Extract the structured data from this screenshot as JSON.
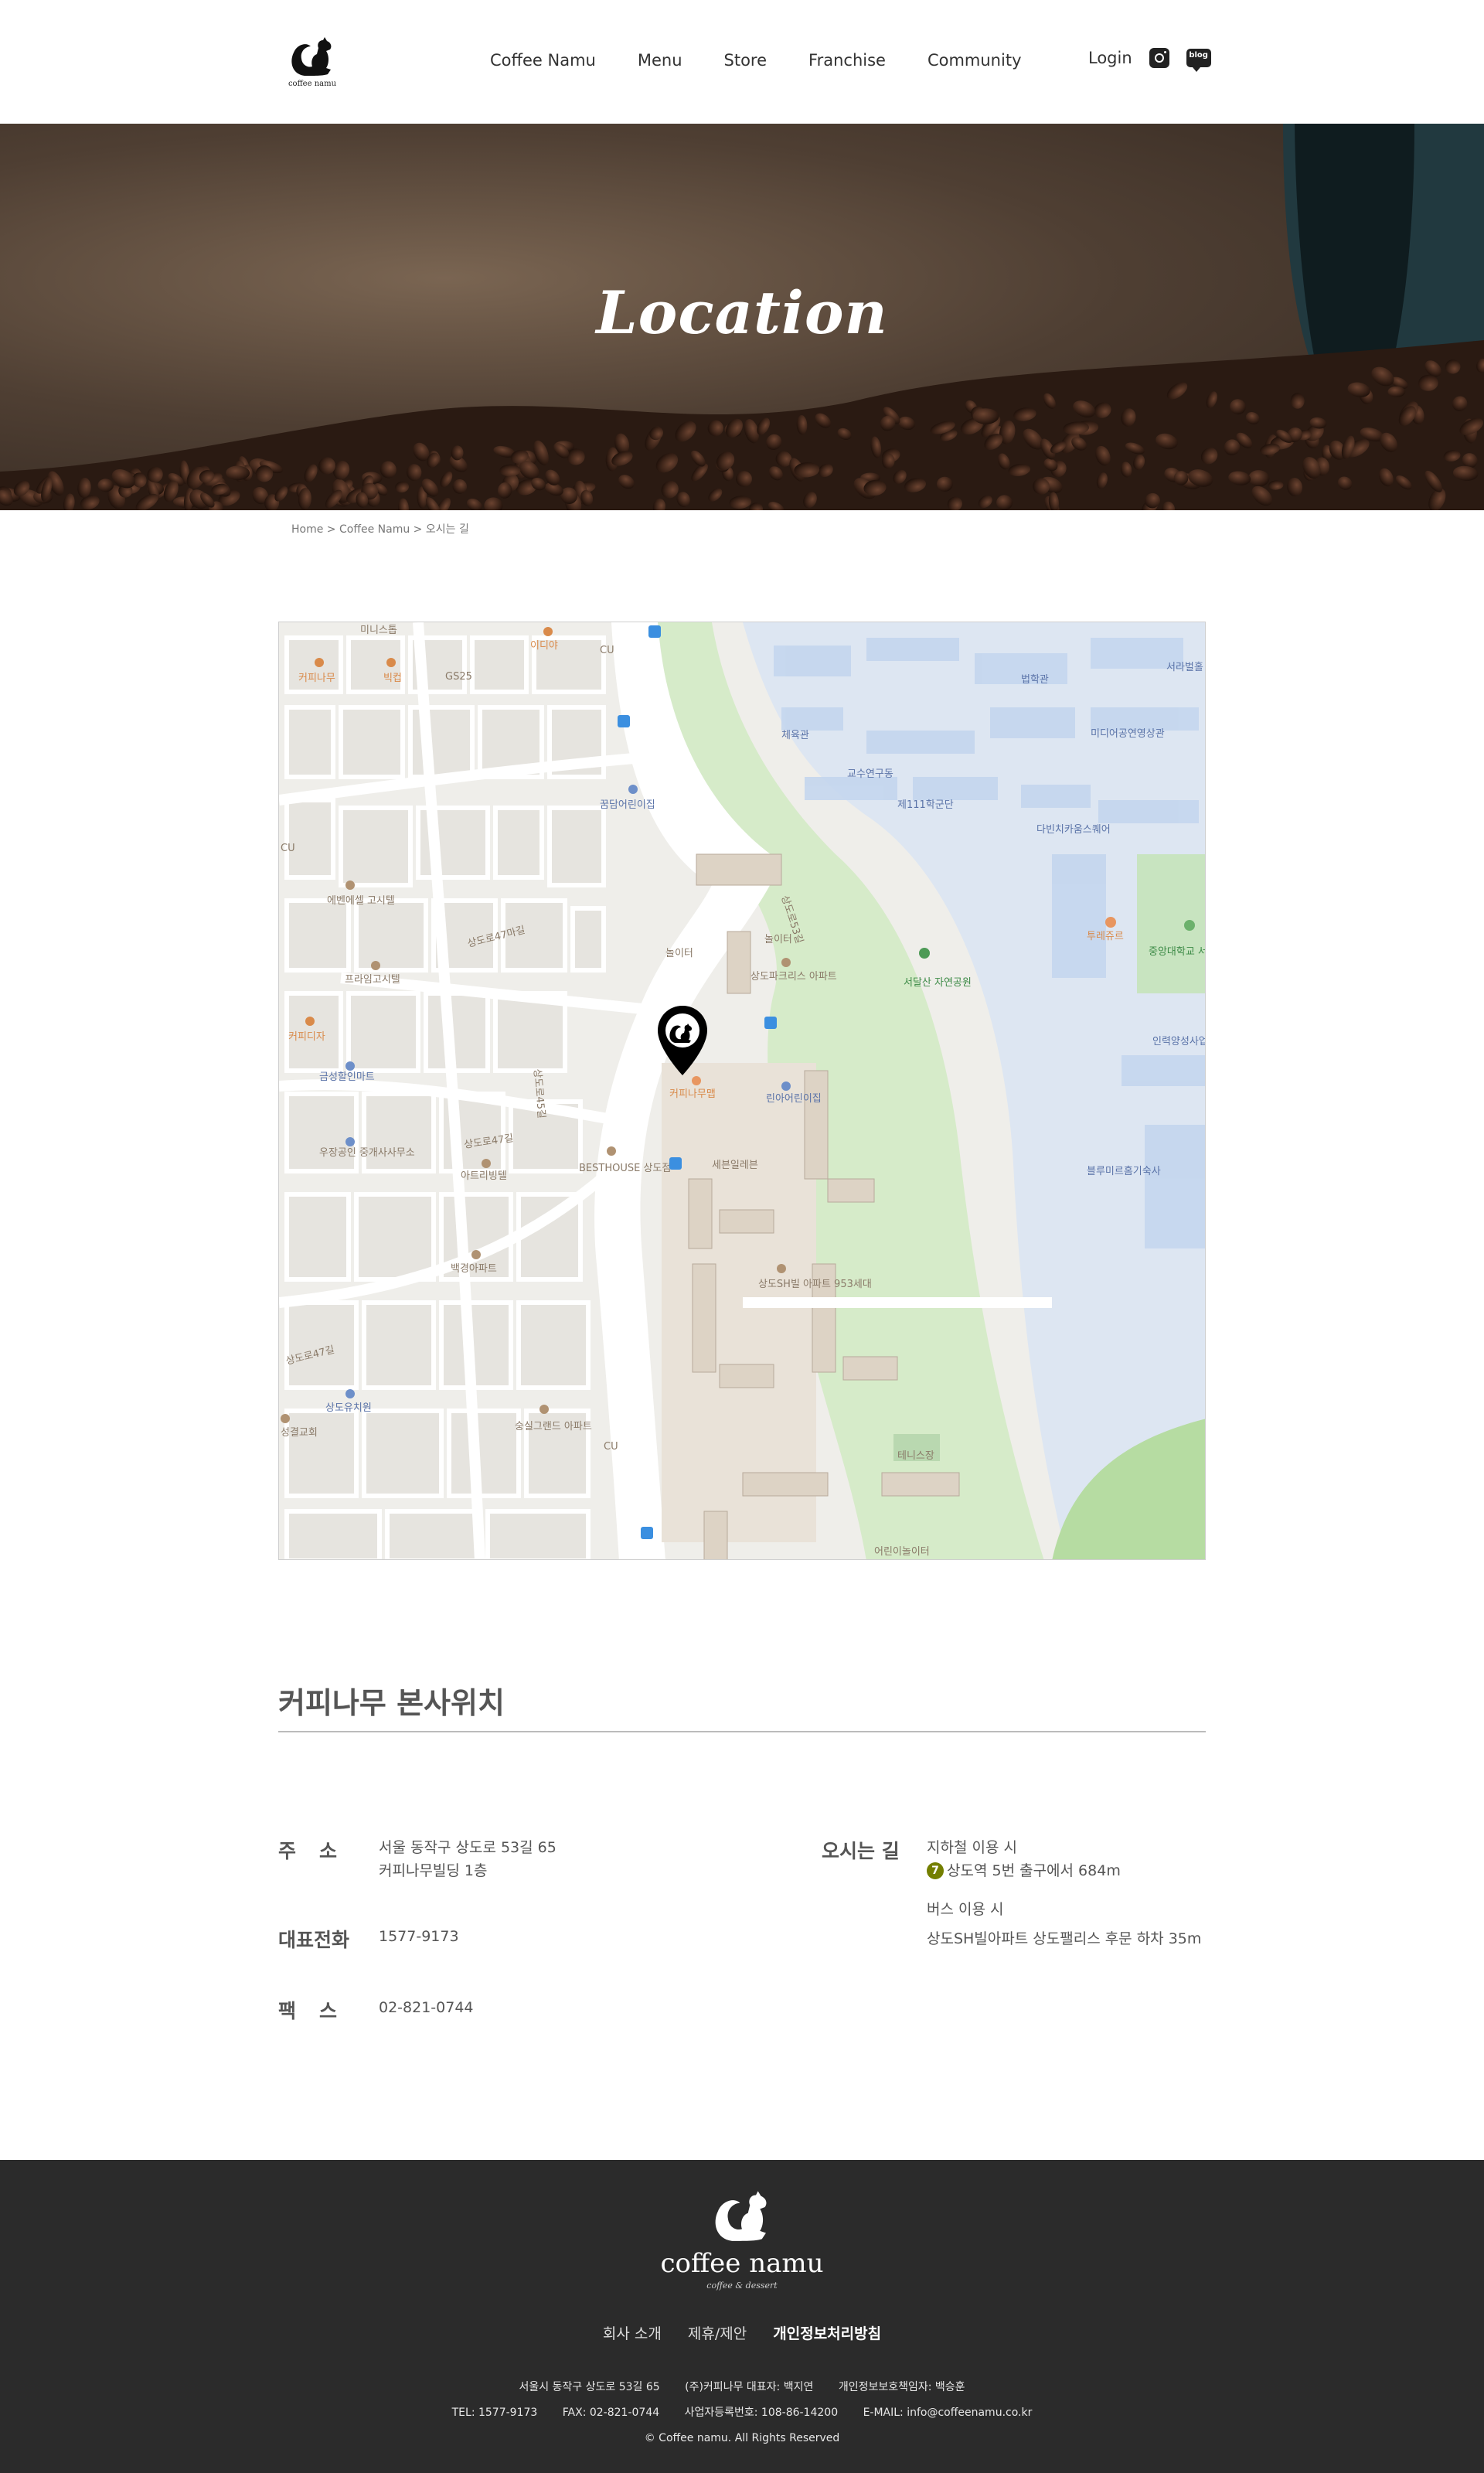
{
  "header": {
    "logo_text": "coffee namu",
    "nav": [
      "Coffee Namu",
      "Menu",
      "Store",
      "Franchise",
      "Community"
    ],
    "login": "Login",
    "blog_badge": "blog"
  },
  "hero": {
    "title": "Location"
  },
  "breadcrumb": {
    "home": "Home",
    "sep": ">",
    "section": "Coffee Namu",
    "page": "오시는 길"
  },
  "map": {
    "marker_label": "커피나무맵",
    "labels": {
      "l1": "미니스톱",
      "l2": "이디야",
      "l3": "CU",
      "l4": "커피나무",
      "l5": "빅컵",
      "l6": "GS25",
      "l7": "체육관",
      "l8": "법학관",
      "l9": "서라벌홀",
      "l10": "미디어공연영상관",
      "l11": "교수연구동",
      "l12": "제111학군단",
      "l13": "다빈치카움스퀘어",
      "l14": "꿈담어린이집",
      "l15": "CU",
      "l16": "에벤에셀 고시텔",
      "l17": "프라임고시텔",
      "l18": "투레쥬르",
      "l19": "중앙대학교 서울캠퍼스",
      "l20": "서달산 자연공원",
      "l21": "상도파크리스 아파트",
      "l22": "놀이터",
      "l23": "놀이터",
      "l24": "커피디자",
      "l25": "금성할인마트",
      "l26": "인력양성사업",
      "l27": "린아어린이집",
      "l28": "우장공인 중개사사무소",
      "l29": "아트리빙텔",
      "l30": "BESTHOUSE 상도점",
      "l31": "세븐일레븐",
      "l32": "블루미르홈기숙사",
      "l33": "백경아파트",
      "l34": "상도SH빌 아파트 953세대",
      "l35": "상도유치원",
      "l36": "숭실그랜드 아파트",
      "l37": "성결교회",
      "l38": "테니스장",
      "l39": "어린이놀이터",
      "l40": "CU",
      "r1": "상도로53길",
      "r2": "상도로47마길",
      "r3": "상도로47길",
      "r4": "상도로45길"
    }
  },
  "info": {
    "title": "커피나무 본사위치",
    "address_label": "주소",
    "address_line1": "서울 동작구 상도로 53길 65",
    "address_line2": "커피나무빌딩 1층",
    "phone_label": "대표전화",
    "phone": "1577-9173",
    "fax_label": "팩스",
    "fax": "02-821-0744",
    "directions_label": "오시는 길",
    "subway_title": "지하철 이용 시",
    "subway_line": "7",
    "subway_text": "상도역 5번 출구에서 684m",
    "bus_title": "버스 이용 시",
    "bus_text": "상도SH빌아파트 상도팰리스 후문 하차 35m"
  },
  "footer": {
    "brand": "coffee namu",
    "tagline": "coffee & dessert",
    "links": [
      "회사 소개",
      "제휴/제안",
      "개인정보처리방침"
    ],
    "address": "서울시 동작구 상도로 53길 65",
    "company": "(주)커피나무 대표자: 백지연",
    "privacy_officer": "개인정보보호책임자: 백승훈",
    "tel": "TEL: 1577-9173",
    "fax": "FAX: 02-821-0744",
    "biz_no": "사업자등록번호: 108-86-14200",
    "email": "E-MAIL: info@coffeenamu.co.kr",
    "copyright": "© Coffee namu. All Rights Reserved"
  }
}
